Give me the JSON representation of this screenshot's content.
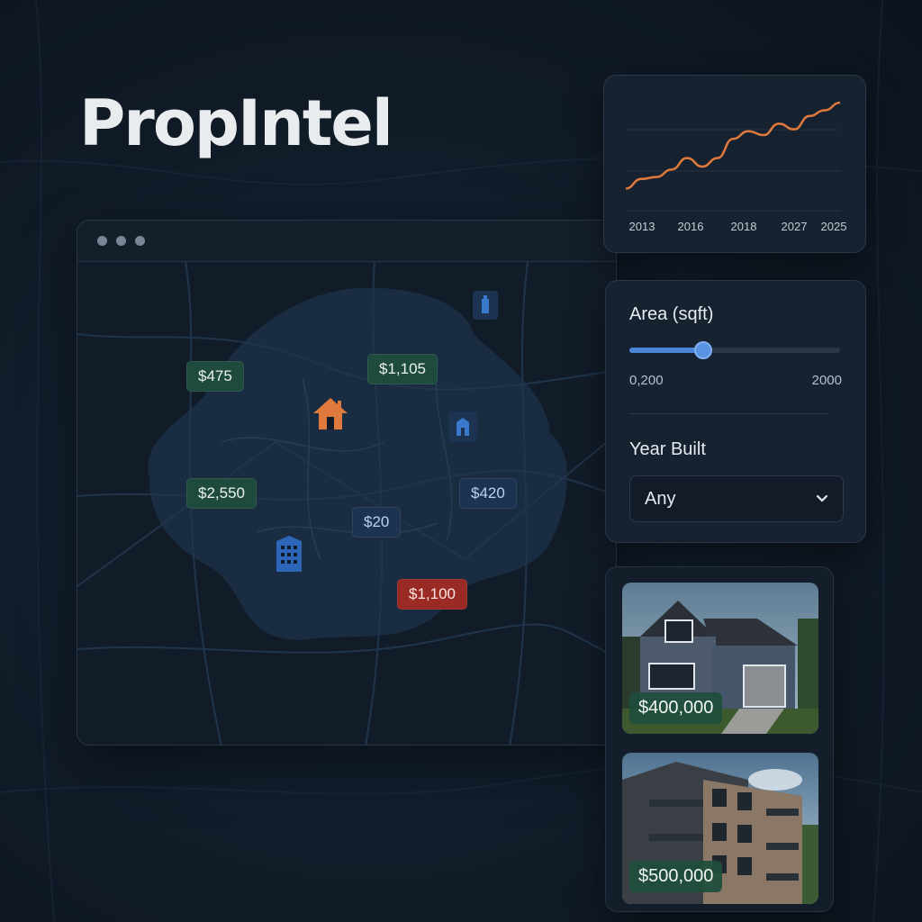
{
  "app": {
    "brand": "PropIntel"
  },
  "map": {
    "window_dots": 3,
    "price_markers": [
      {
        "label": "$475",
        "style": "green"
      },
      {
        "label": "$1,105",
        "style": "green"
      },
      {
        "label": "$2,550",
        "style": "green"
      },
      {
        "label": "$420",
        "style": "blue"
      },
      {
        "label": "$20",
        "style": "blue"
      },
      {
        "label": "$1,100",
        "style": "red"
      }
    ],
    "pins": [
      "house-pin-icon",
      "apartment-building-pin-icon",
      "building-pin-icon",
      "tower-pin-icon"
    ],
    "accent_colors": {
      "highlight_pin": "#e07a3c",
      "pin": "#2b66b8"
    }
  },
  "chart_data": {
    "type": "line",
    "x_tick_labels": [
      "2013",
      "2016",
      "2018",
      "2027",
      "2025"
    ],
    "series": [
      {
        "values": [
          0.1,
          0.2,
          0.22,
          0.3,
          0.42,
          0.33,
          0.42,
          0.62,
          0.7,
          0.66,
          0.78,
          0.72,
          0.86,
          0.92,
          1.0
        ]
      }
    ],
    "line_color": "#e07a3c",
    "grid": true
  },
  "filters": {
    "area": {
      "label": "Area (sqft)",
      "min_label": "0,200",
      "max_label": "2000",
      "value_fraction": 0.35
    },
    "year_built": {
      "label": "Year Built",
      "selected": "Any"
    }
  },
  "listings": [
    {
      "price": "$400,000",
      "image": "house-photo"
    },
    {
      "price": "$500,000",
      "image": "apartment-photo"
    }
  ]
}
